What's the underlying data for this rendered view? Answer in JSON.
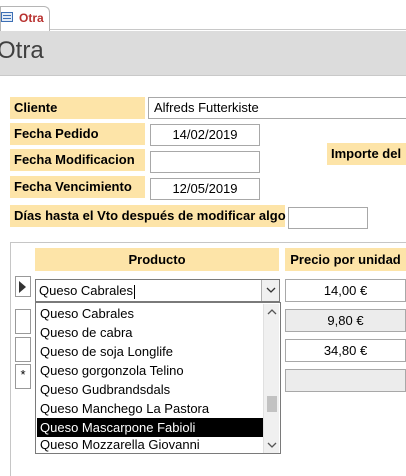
{
  "tab": {
    "label": "Otra",
    "icon": "form-icon"
  },
  "form": {
    "title": "Otra"
  },
  "fields": {
    "cliente": {
      "label": "Cliente",
      "value": "Alfreds Futterkiste"
    },
    "fecha_pedido": {
      "label": "Fecha Pedido",
      "value": "14/02/2019"
    },
    "fecha_modificacion": {
      "label": "Fecha Modificacion",
      "value": ""
    },
    "fecha_vencimiento": {
      "label": "Fecha Vencimiento",
      "value": "12/05/2019"
    },
    "importe": {
      "label": "Importe del"
    },
    "dias": {
      "label": "Días hasta el Vto después de modificar algo",
      "value": ""
    }
  },
  "subform": {
    "headers": {
      "producto": "Producto",
      "precio": "Precio por unidad"
    },
    "rows": [
      {
        "producto": "Queso Cabrales",
        "precio": "14,00 €"
      },
      {
        "producto": "",
        "precio": "9,80 €"
      },
      {
        "producto": "",
        "precio": "34,80 €"
      },
      {
        "producto": "",
        "precio": ""
      }
    ],
    "new_row_marker": "*"
  },
  "dropdown": {
    "options": [
      "Queso Cabrales",
      "Queso de cabra",
      "Queso de soja Longlife",
      "Queso gorgonzola Telino",
      "Queso Gudbrandsdals",
      "Queso Manchego La Pastora",
      "Queso Mascarpone Fabioli",
      "Queso Mozzarella Giovanni"
    ],
    "selected": "Queso Mascarpone Fabioli"
  },
  "colors": {
    "label_bg": "#fde4a8",
    "tab_text": "#b8312f",
    "header_bg": "#dcdcdc"
  }
}
